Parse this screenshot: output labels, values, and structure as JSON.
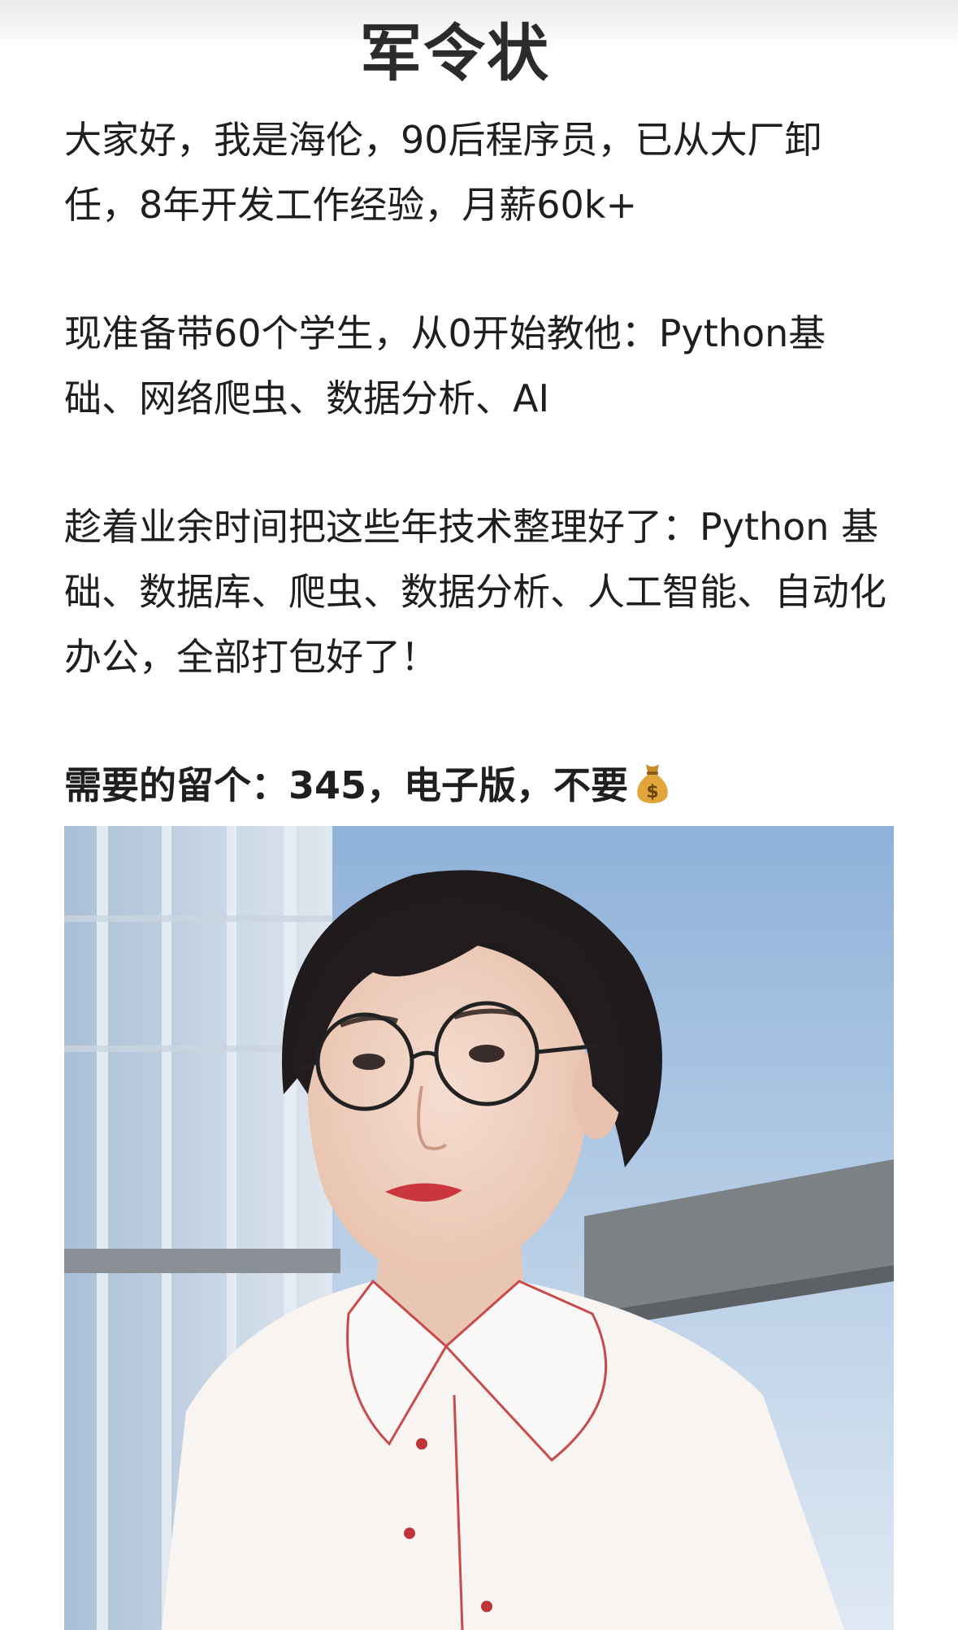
{
  "post": {
    "title": "军令状",
    "paragraphs": [
      "大家好，我是海伦，90后程序员，已从大厂卸任，8年开发工作经验，月薪60k+",
      "现准备带60个学生，从0开始教他：Python基础、网络爬虫、数据分析、AI",
      "趁着业余时间把这些年技术整理好了：Python 基础、数据库、爬虫、数据分析、人工智能、自动化办公，全部打包好了！"
    ],
    "cta": "需要的留个：345，电子版，不要",
    "cta_icon": "money-bag-icon",
    "image_icon": "portrait-photo"
  },
  "colors": {
    "text": "#1f1f1f",
    "title": "#2b2b2b",
    "background": "#ffffff"
  }
}
